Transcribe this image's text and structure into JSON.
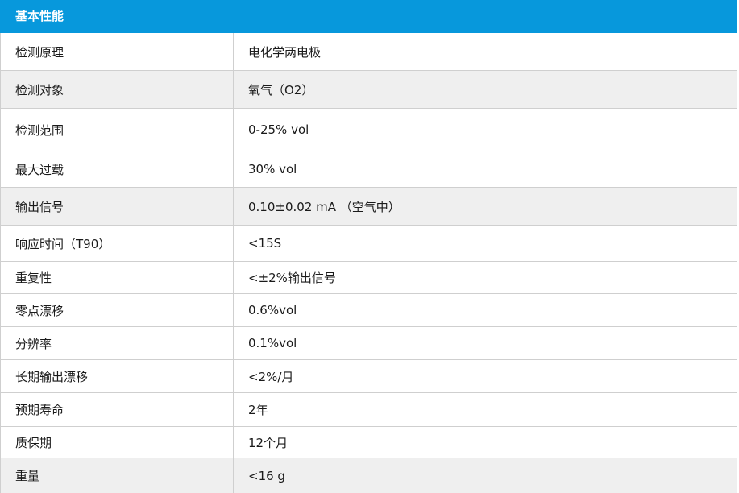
{
  "section": {
    "title": "基本性能"
  },
  "rows": [
    {
      "label": "检测原理",
      "value": "电化学两电极"
    },
    {
      "label": "检测对象",
      "value": "氧气（O2）"
    },
    {
      "label": "检测范围",
      "value": "0-25% vol"
    },
    {
      "label": "最大过载",
      "value": "30% vol"
    },
    {
      "label": "输出信号",
      "value": "0.10±0.02 mA （空气中）"
    },
    {
      "label": "响应时间（T90）",
      "value": "<15S"
    },
    {
      "label": "重复性",
      "value": "<±2%输出信号"
    },
    {
      "label": "零点漂移",
      "value": "0.6%vol"
    },
    {
      "label": "分辨率",
      "value": "0.1%vol"
    },
    {
      "label": "长期输出漂移",
      "value": "<2%/月"
    },
    {
      "label": "预期寿命",
      "value": "2年"
    },
    {
      "label": "质保期",
      "value": "12个月"
    },
    {
      "label": "重量",
      "value": "<16 g"
    }
  ],
  "colors": {
    "header_bg": "#0798dc",
    "alt_row_bg": "#efefef",
    "border": "#cfcfcf"
  }
}
